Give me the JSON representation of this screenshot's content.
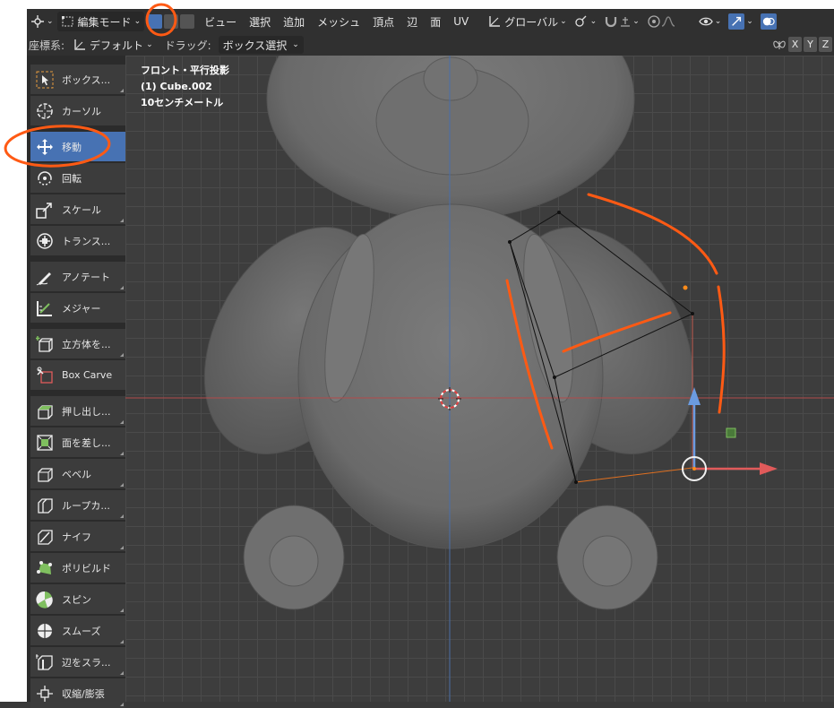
{
  "header": {
    "mode_label": "編集モード",
    "menus": [
      "ビュー",
      "選択",
      "追加",
      "メッシュ",
      "頂点",
      "辺",
      "面",
      "UV"
    ],
    "transform_orientation": "グローバル"
  },
  "subheader": {
    "coord_label": "座標系:",
    "coord_value": "デフォルト",
    "drag_label": "ドラッグ:",
    "drag_value": "ボックス選択",
    "axes": [
      "X",
      "Y",
      "Z"
    ]
  },
  "viewport": {
    "view_name": "フロント・平行投影",
    "object_name": "(1) Cube.002",
    "scale": "10センチメートル"
  },
  "tools": [
    {
      "label": "ボックス...",
      "icon": "box-select-icon"
    },
    {
      "label": "カーソル",
      "icon": "cursor-icon"
    },
    {
      "label": "移動",
      "icon": "move-icon"
    },
    {
      "label": "回転",
      "icon": "rotate-icon"
    },
    {
      "label": "スケール",
      "icon": "scale-icon"
    },
    {
      "label": "トランス...",
      "icon": "transform-icon"
    },
    {
      "label": "アノテート",
      "icon": "annotate-icon"
    },
    {
      "label": "メジャー",
      "icon": "measure-icon"
    },
    {
      "label": "立方体を...",
      "icon": "add-cube-icon"
    },
    {
      "label": "Box Carve",
      "icon": "box-carve-icon"
    },
    {
      "label": "押し出し...",
      "icon": "extrude-icon"
    },
    {
      "label": "面を差し...",
      "icon": "inset-faces-icon"
    },
    {
      "label": "ベベル",
      "icon": "bevel-icon"
    },
    {
      "label": "ループカ...",
      "icon": "loop-cut-icon"
    },
    {
      "label": "ナイフ",
      "icon": "knife-icon"
    },
    {
      "label": "ポリビルド",
      "icon": "poly-build-icon"
    },
    {
      "label": "スピン",
      "icon": "spin-icon"
    },
    {
      "label": "スムーズ",
      "icon": "smooth-icon"
    },
    {
      "label": "辺をスラ...",
      "icon": "edge-slide-icon"
    },
    {
      "label": "収縮/膨張",
      "icon": "shrink-fatten-icon"
    }
  ],
  "colors": {
    "accent": "#4772b3",
    "annotation": "#ff5a14",
    "x_axis": "#d9534f",
    "z_axis": "#5b8fd6"
  }
}
